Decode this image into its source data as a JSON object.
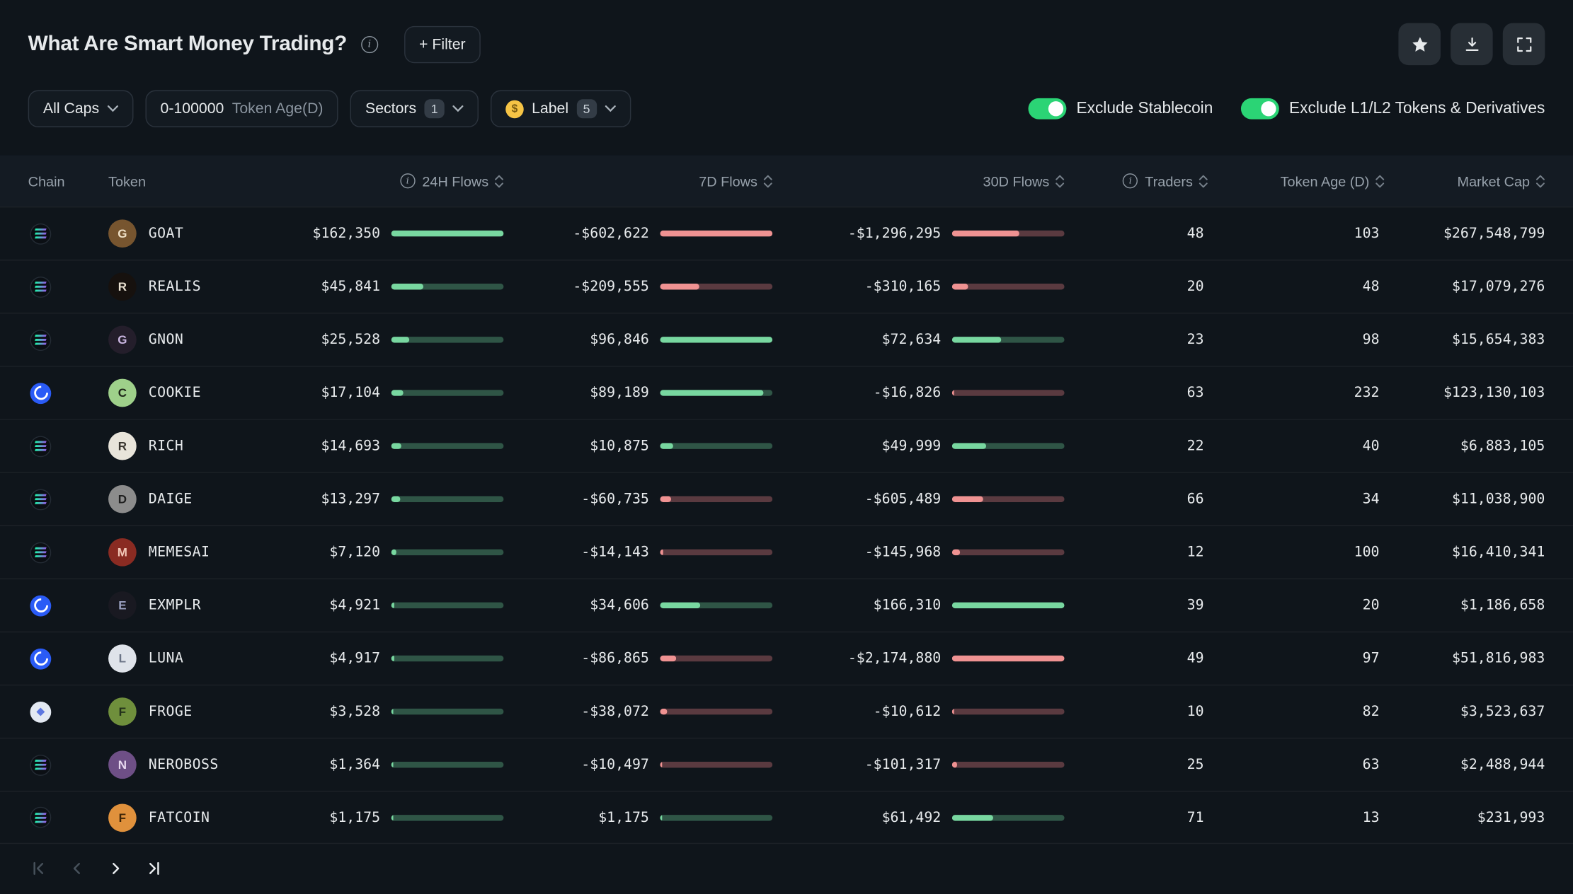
{
  "header": {
    "title": "What Are Smart Money Trading?",
    "filter_button_label": "+ Filter"
  },
  "filters": {
    "market_cap_label": "All Caps",
    "token_age_value": "0-100000",
    "token_age_label": "Token Age(D)",
    "sectors_label": "Sectors",
    "sectors_count": "1",
    "label_label": "Label",
    "label_count": "5",
    "label_emoji": "money-face",
    "exclude_stablecoin_label": "Exclude Stablecoin",
    "exclude_stablecoin_on": true,
    "exclude_l1l2_label": "Exclude L1/L2 Tokens & Derivatives",
    "exclude_l1l2_on": true
  },
  "table": {
    "columns": {
      "chain": "Chain",
      "token": "Token",
      "flows_24h": "24H Flows",
      "flows_7d": "7D Flows",
      "flows_30d": "30D Flows",
      "traders": "Traders",
      "token_age": "Token Age (D)",
      "market_cap": "Market Cap"
    },
    "rows": [
      {
        "chain": "solana",
        "token": "GOAT",
        "flow_24h": "$162,350",
        "flow_7d": "-$602,622",
        "flow_30d": "-$1,296,295",
        "traders": "48",
        "token_age": "103",
        "market_cap": "$267,548,799",
        "avatar_bg": "#77552f",
        "avatar_fg": "#f0e2c8"
      },
      {
        "chain": "solana",
        "token": "REALIS",
        "flow_24h": "$45,841",
        "flow_7d": "-$209,555",
        "flow_30d": "-$310,165",
        "traders": "20",
        "token_age": "48",
        "market_cap": "$17,079,276",
        "avatar_bg": "#16110e",
        "avatar_fg": "#e8e0d0"
      },
      {
        "chain": "solana",
        "token": "GNON",
        "flow_24h": "$25,528",
        "flow_7d": "$96,846",
        "flow_30d": "$72,634",
        "traders": "23",
        "token_age": "98",
        "market_cap": "$15,654,383",
        "avatar_bg": "#241e2b",
        "avatar_fg": "#cbb7e2"
      },
      {
        "chain": "base",
        "token": "COOKIE",
        "flow_24h": "$17,104",
        "flow_7d": "$89,189",
        "flow_30d": "-$16,826",
        "traders": "63",
        "token_age": "232",
        "market_cap": "$123,130,103",
        "avatar_bg": "#9ed08a",
        "avatar_fg": "#1c2417"
      },
      {
        "chain": "solana",
        "token": "RICH",
        "flow_24h": "$14,693",
        "flow_7d": "$10,875",
        "flow_30d": "$49,999",
        "traders": "22",
        "token_age": "40",
        "market_cap": "$6,883,105",
        "avatar_bg": "#e8e4da",
        "avatar_fg": "#3a3630"
      },
      {
        "chain": "solana",
        "token": "DAIGE",
        "flow_24h": "$13,297",
        "flow_7d": "-$60,735",
        "flow_30d": "-$605,489",
        "traders": "66",
        "token_age": "34",
        "market_cap": "$11,038,900",
        "avatar_bg": "#8c8c8c",
        "avatar_fg": "#1f1f1f"
      },
      {
        "chain": "solana",
        "token": "MEMESAI",
        "flow_24h": "$7,120",
        "flow_7d": "-$14,143",
        "flow_30d": "-$145,968",
        "traders": "12",
        "token_age": "100",
        "market_cap": "$16,410,341",
        "avatar_bg": "#8a2b22",
        "avatar_fg": "#f3c8b8"
      },
      {
        "chain": "base",
        "token": "EXMPLR",
        "flow_24h": "$4,921",
        "flow_7d": "$34,606",
        "flow_30d": "$166,310",
        "traders": "39",
        "token_age": "20",
        "market_cap": "$1,186,658",
        "avatar_bg": "#191921",
        "avatar_fg": "#9aa0c0"
      },
      {
        "chain": "base",
        "token": "LUNA",
        "flow_24h": "$4,917",
        "flow_7d": "-$86,865",
        "flow_30d": "-$2,174,880",
        "traders": "49",
        "token_age": "97",
        "market_cap": "$51,816,983",
        "avatar_bg": "#dfe3ea",
        "avatar_fg": "#6b7486"
      },
      {
        "chain": "ethereum",
        "token": "FROGE",
        "flow_24h": "$3,528",
        "flow_7d": "-$38,072",
        "flow_30d": "-$10,612",
        "traders": "10",
        "token_age": "82",
        "market_cap": "$3,523,637",
        "avatar_bg": "#6f8f3c",
        "avatar_fg": "#22301a"
      },
      {
        "chain": "solana",
        "token": "NEROBOSS",
        "flow_24h": "$1,364",
        "flow_7d": "-$10,497",
        "flow_30d": "-$101,317",
        "traders": "25",
        "token_age": "63",
        "market_cap": "$2,488,944",
        "avatar_bg": "#6e4f86",
        "avatar_fg": "#e8d8f0"
      },
      {
        "chain": "solana",
        "token": "FATCOIN",
        "flow_24h": "$1,175",
        "flow_7d": "$1,175",
        "flow_30d": "$61,492",
        "traders": "71",
        "token_age": "13",
        "market_cap": "$231,993",
        "avatar_bg": "#e0913c",
        "avatar_fg": "#3d2508"
      }
    ]
  },
  "pagination": {
    "first_enabled": false,
    "prev_enabled": false,
    "next_enabled": true,
    "last_enabled": true
  },
  "colors": {
    "positive_fill": "#78d7a0",
    "positive_track": "#2f5546",
    "negative_fill": "#ef9292",
    "negative_track": "#5a3a40",
    "toggle_on": "#2bd475"
  }
}
